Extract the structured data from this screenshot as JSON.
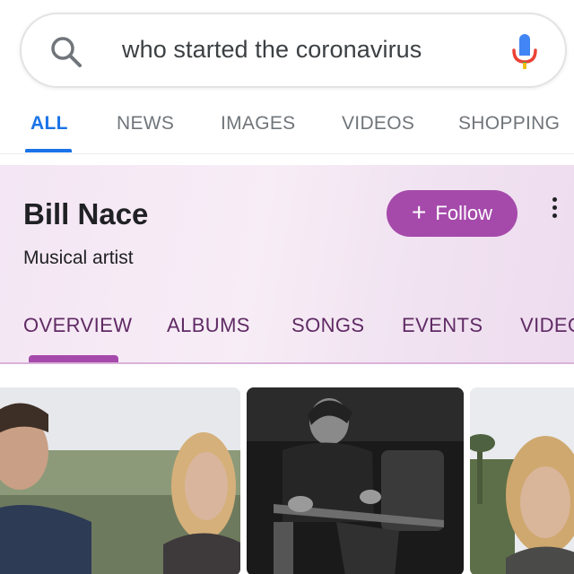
{
  "search": {
    "query": "who started the coronavirus"
  },
  "tabs": [
    "ALL",
    "NEWS",
    "IMAGES",
    "VIDEOS",
    "SHOPPING"
  ],
  "knowledge_panel": {
    "title": "Bill Nace",
    "subtitle": "Musical artist",
    "follow_label": "Follow",
    "tabs": [
      "OVERVIEW",
      "ALBUMS",
      "SONGS",
      "EVENTS",
      "VIDEO"
    ]
  },
  "colors": {
    "accent_blue": "#1a73e8",
    "follow_purple": "#a54aab",
    "panel_tab_text": "#5f2a64"
  },
  "icons": {
    "search": "search-icon",
    "mic": "mic-icon",
    "plus": "plus-icon",
    "more": "more-vert-icon"
  }
}
